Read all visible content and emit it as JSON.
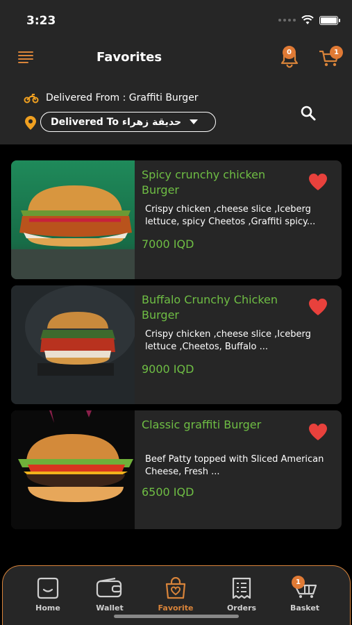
{
  "status_bar": {
    "time": "3:23"
  },
  "header": {
    "title": "Favorites",
    "notification_count": "0",
    "cart_count": "1",
    "delivered_from": "Delivered From : Graffiti Burger",
    "address": "Delivered To حديقة زهراء"
  },
  "favorites": [
    {
      "title": "Spicy crunchy chicken Burger",
      "description": "Crispy chicken ,cheese slice ,Iceberg lettuce, spicy Cheetos ,Graffiti spicy...",
      "price": "7000 IQD"
    },
    {
      "title": "Buffalo Crunchy Chicken Burger",
      "description": "Crispy chicken ,cheese slice ,Iceberg lettuce ,Cheetos, Buffalo ...",
      "price": "9000 IQD"
    },
    {
      "title": "Classic graffiti Burger",
      "description": "Beef Patty topped with Sliced American Cheese, Fresh ...",
      "price": "6500 IQD"
    }
  ],
  "bottom_nav": {
    "items": [
      {
        "label": "Home"
      },
      {
        "label": "Wallet"
      },
      {
        "label": "Favorite"
      },
      {
        "label": "Orders"
      },
      {
        "label": "Basket",
        "badge": "1"
      }
    ],
    "active": "Favorite"
  },
  "colors": {
    "accent": "#d9843a",
    "price_green": "#6fbe44",
    "heart_red": "#e8413c",
    "card_bg": "#262626",
    "page_bg": "#000000"
  }
}
